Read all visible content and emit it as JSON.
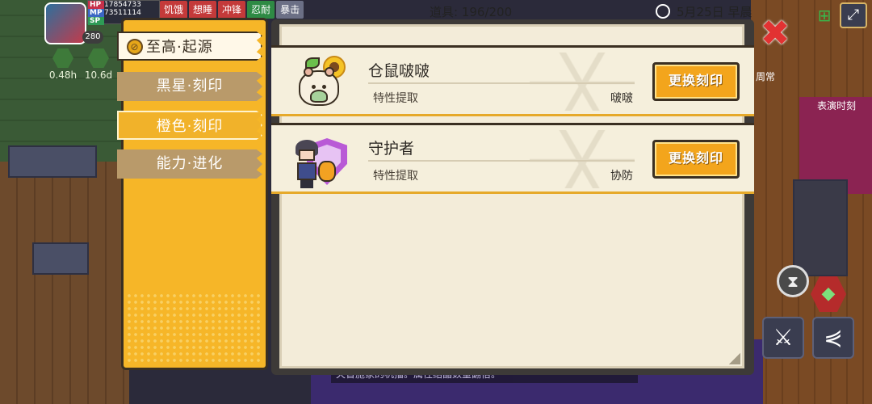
{
  "hud": {
    "level": "280",
    "hp_label": "HP",
    "hp_value": "17854733",
    "mp_label": "MP",
    "mp_value": "73511114",
    "sp_label": "SP",
    "status_tags": [
      {
        "label": "饥饿",
        "color": "#c43a3a"
      },
      {
        "label": "想睡",
        "color": "#c43a3a"
      },
      {
        "label": "冲锋",
        "color": "#c43a3a"
      },
      {
        "label": "忍耐",
        "color": "#2e8a44"
      },
      {
        "label": "暴击",
        "color": "#6b6f85"
      }
    ],
    "timers": [
      "0.48h",
      "10.6d"
    ],
    "items": "道具: 196/200",
    "date": "5月25日 早晨"
  },
  "side": {
    "label_weekly": "周常",
    "label_show_time": "表演时刻"
  },
  "scene": {
    "bottom_message": "天音施家的机播。属性结晶数量翻倍。"
  },
  "tabs": [
    {
      "label": "至高·起源",
      "icon": "compass-icon"
    },
    {
      "label": "黑星·刻印"
    },
    {
      "label": "橙色·刻印"
    },
    {
      "label": "能力·进化"
    }
  ],
  "rows": [
    {
      "name": "仓鼠啵啵",
      "trait_label": "特性提取",
      "trait_value": "啵啵",
      "button": "更换刻印"
    },
    {
      "name": "守护者",
      "trait_label": "特性提取",
      "trait_value": "协防",
      "button": "更换刻印"
    }
  ],
  "colors": {
    "accent": "#f6b628",
    "button": "#f3a51c",
    "close": "#e23232"
  }
}
